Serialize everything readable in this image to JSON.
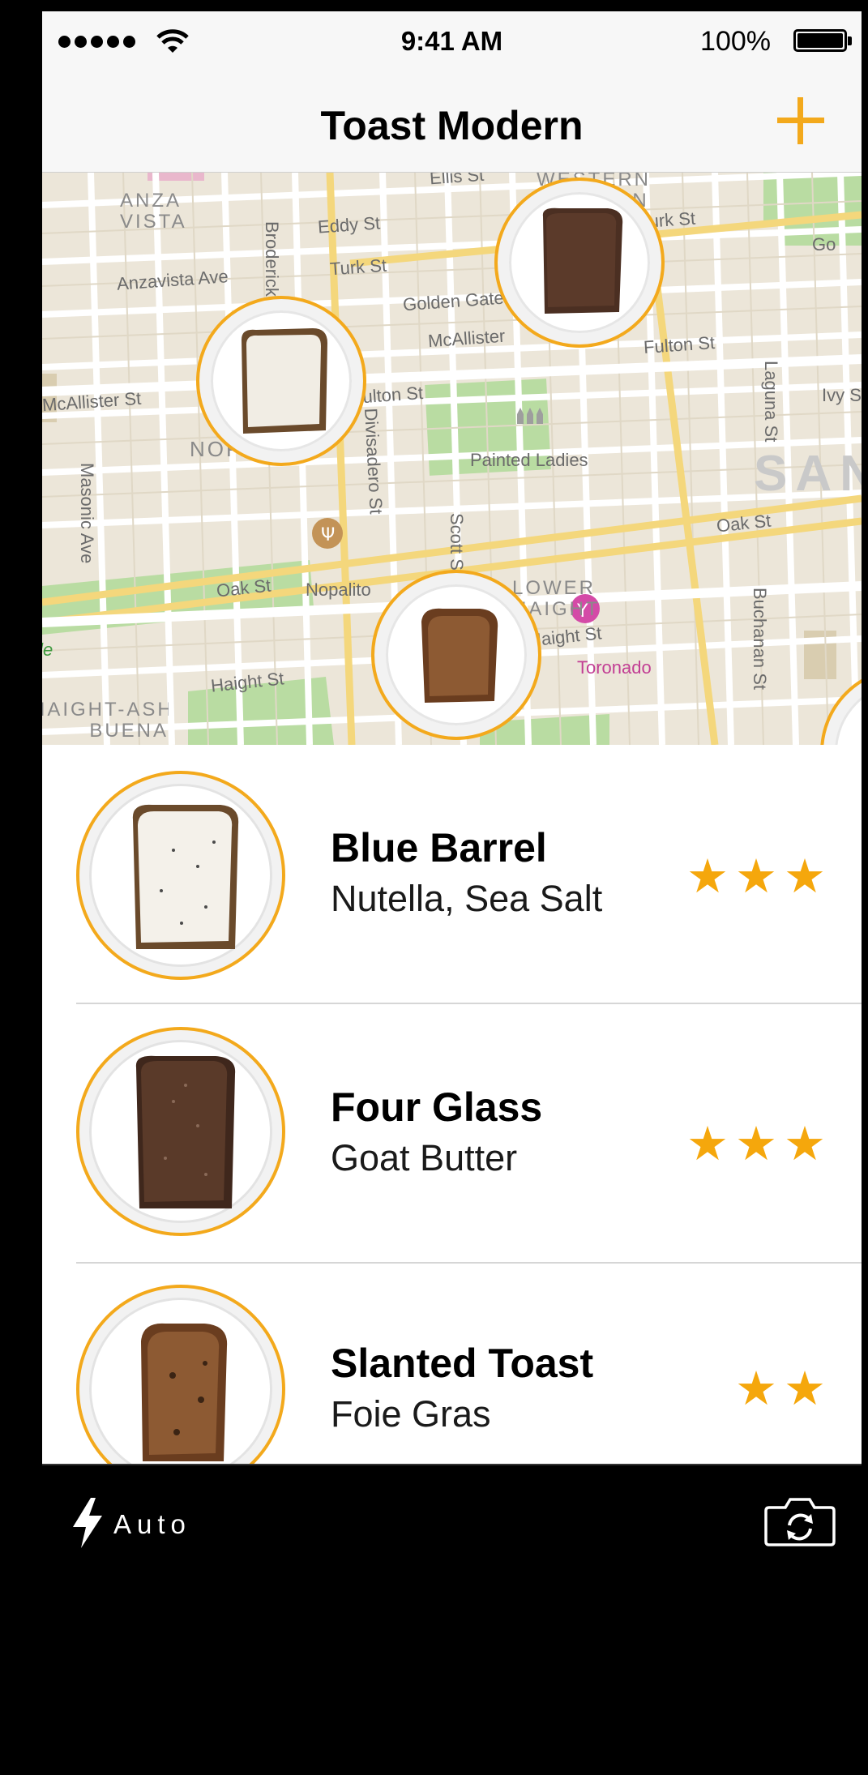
{
  "status": {
    "time": "9:41 AM",
    "battery": "100%"
  },
  "nav": {
    "title": "Toast Modern",
    "add_icon": "plus-icon",
    "accent": "#f3a91c"
  },
  "map": {
    "labels": {
      "anza_vista": "ANZA\nVISTA",
      "western_addition": "WESTERN\nADDITION",
      "ellis": "Ellis St",
      "eddy": "Eddy St",
      "turk_left": "Turk St",
      "turk_right": "Turk St",
      "anzavista_ave": "Anzavista Ave",
      "broderick": "Broderick",
      "golden_gate": "Golden Gate",
      "mcallister_left": "McAllister St",
      "mcallister_mid": "McAllister",
      "fulton_mid": "Fulton St",
      "fulton_right": "Fulton St",
      "laguna": "Laguna St",
      "ivy": "Ivy St",
      "painted_ladies": "Painted Ladies",
      "divisadero": "Divisadero St",
      "masonic": "Masonic Ave",
      "scott": "Scott St",
      "oak_left": "Oak St",
      "oak_right": "Oak St",
      "nopalito": "Nopalito",
      "lower_haight": "LOWER\nHAIGHT",
      "haight_left": "Haight St",
      "haight_mid": "Haight St",
      "toronado": "Toronado",
      "buchanan": "Buchanan St",
      "panhandle": "Panhandle",
      "ashbury": "HAIGHT-ASHBURY\nBUENA",
      "nopa": "NOPA",
      "san_francisco": "SAN",
      "go": "Go"
    }
  },
  "toasts": [
    {
      "name": "Blue Barrel",
      "topping": "Nutella, Sea Salt",
      "stars": "★★★",
      "rating": 3
    },
    {
      "name": "Four Glass",
      "topping": "Goat Butter",
      "stars": "★★★",
      "rating": 3
    },
    {
      "name": "Slanted Toast",
      "topping": "Foie Gras",
      "stars": "★★",
      "rating": 2
    }
  ],
  "camera": {
    "flash_label": "Auto",
    "flash_icon": "lightning-icon",
    "flip_icon": "camera-flip-icon"
  }
}
